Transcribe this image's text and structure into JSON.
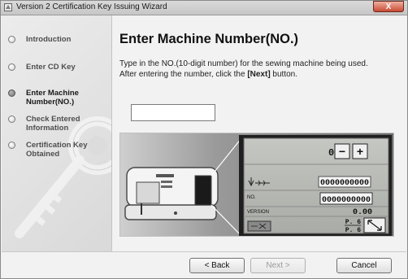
{
  "window": {
    "title": "Version 2 Certification Key Issuing Wizard",
    "close_label": "X"
  },
  "sidebar": {
    "steps": [
      {
        "label": "Introduction",
        "active": false
      },
      {
        "label": "Enter CD Key",
        "active": false
      },
      {
        "label": "Enter Machine Number(NO.)",
        "active": true
      },
      {
        "label": "Check Entered Information",
        "active": false
      },
      {
        "label": "Certification Key Obtained",
        "active": false
      }
    ]
  },
  "main": {
    "title": "Enter Machine Number(NO.)",
    "desc_line1": "Type in the NO.(10-digit number) for the sewing machine being used.",
    "desc_line2_prefix": "After entering the number, click the ",
    "desc_line2_bold": "[Next]",
    "desc_line2_suffix": " button.",
    "machine_number_value": "",
    "machine_number_placeholder": ""
  },
  "panel": {
    "counter_value": "0",
    "minus_label": "−",
    "plus_label": "+",
    "row1_value": "0000000000",
    "no_label": "NO.",
    "no_value": "0000000000",
    "version_label": "VERSION",
    "version_value": "0.00",
    "page_top": "P. 6",
    "page_bottom": "P. 6"
  },
  "footer": {
    "back_label": "< Back",
    "next_label": "Next >",
    "cancel_label": "Cancel"
  }
}
